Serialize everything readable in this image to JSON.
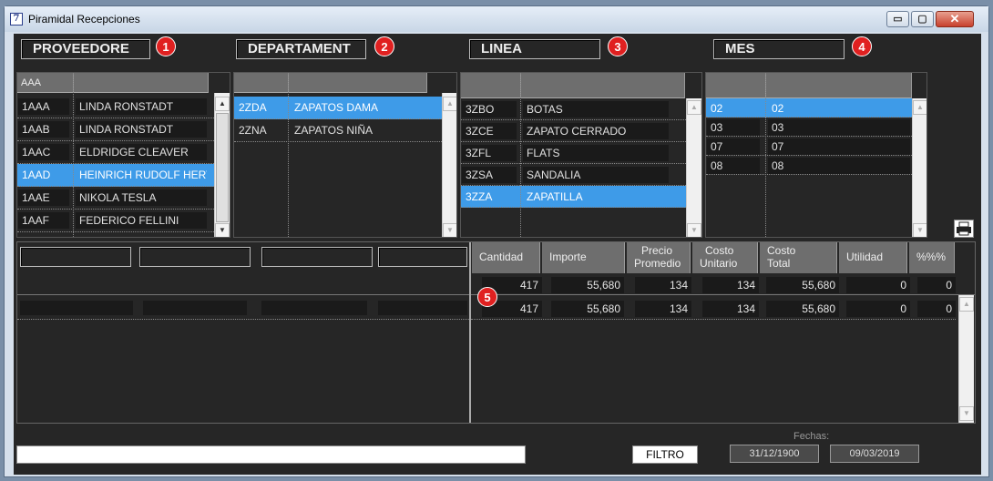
{
  "window": {
    "title": "Piramidal Recepciones",
    "app_icon_glyph": "7",
    "min_glyph": "▭",
    "max_glyph": "▢",
    "close_glyph": "✕"
  },
  "sections": [
    {
      "label": "PROVEEDORE",
      "badge": "1"
    },
    {
      "label": "DEPARTAMENT",
      "badge": "2"
    },
    {
      "label": "LINEA",
      "badge": "3"
    },
    {
      "label": "MES",
      "badge": "4"
    }
  ],
  "badge5": "5",
  "proveedores": {
    "header_code": "AAA",
    "rows": [
      {
        "code": "1AAA",
        "name": "LINDA RONSTADT"
      },
      {
        "code": "1AAB",
        "name": "LINDA RONSTADT"
      },
      {
        "code": "1AAC",
        "name": "ELDRIDGE CLEAVER"
      },
      {
        "code": "1AAD",
        "name": "HEINRICH RUDOLF HERTZ"
      },
      {
        "code": "1AAE",
        "name": "NIKOLA TESLA"
      },
      {
        "code": "1AAF",
        "name": "FEDERICO FELLINI"
      }
    ]
  },
  "departamentos": {
    "rows": [
      {
        "code": "2ZDA",
        "name": "ZAPATOS DAMA"
      },
      {
        "code": "2ZNA",
        "name": "ZAPATOS NIÑA"
      }
    ]
  },
  "lineas": {
    "rows": [
      {
        "code": "3ZBO",
        "name": "BOTAS"
      },
      {
        "code": "3ZCE",
        "name": "ZAPATO CERRADO"
      },
      {
        "code": "3ZFL",
        "name": "FLATS"
      },
      {
        "code": "3ZSA",
        "name": "SANDALIA"
      },
      {
        "code": "3ZZA",
        "name": "ZAPATILLA"
      }
    ]
  },
  "meses": {
    "rows": [
      {
        "code": "02",
        "name": "02"
      },
      {
        "code": "03",
        "name": "03"
      },
      {
        "code": "07",
        "name": "07"
      },
      {
        "code": "08",
        "name": "08"
      }
    ]
  },
  "pivot": {
    "headers": [
      {
        "l1": "Cantidad",
        "l2": ""
      },
      {
        "l1": "Importe",
        "l2": ""
      },
      {
        "l1": "Precio",
        "l2": "Promedio"
      },
      {
        "l1": "Costo",
        "l2": "Unitario"
      },
      {
        "l1": "Costo",
        "l2": "Total"
      },
      {
        "l1": "Utilidad",
        "l2": ""
      },
      {
        "l1": "%%%",
        "l2": ""
      }
    ],
    "totals": [
      "417",
      "55,680",
      "134",
      "134",
      "55,680",
      "0",
      "0"
    ],
    "rows": [
      [
        "417",
        "55,680",
        "134",
        "134",
        "55,680",
        "0",
        "0"
      ]
    ]
  },
  "footer": {
    "filter_button": "FILTRO",
    "fechas_label": "Fechas:",
    "date_from": "31/12/1900",
    "date_to": "09/03/2019",
    "printer_icon": "printer-icon"
  }
}
